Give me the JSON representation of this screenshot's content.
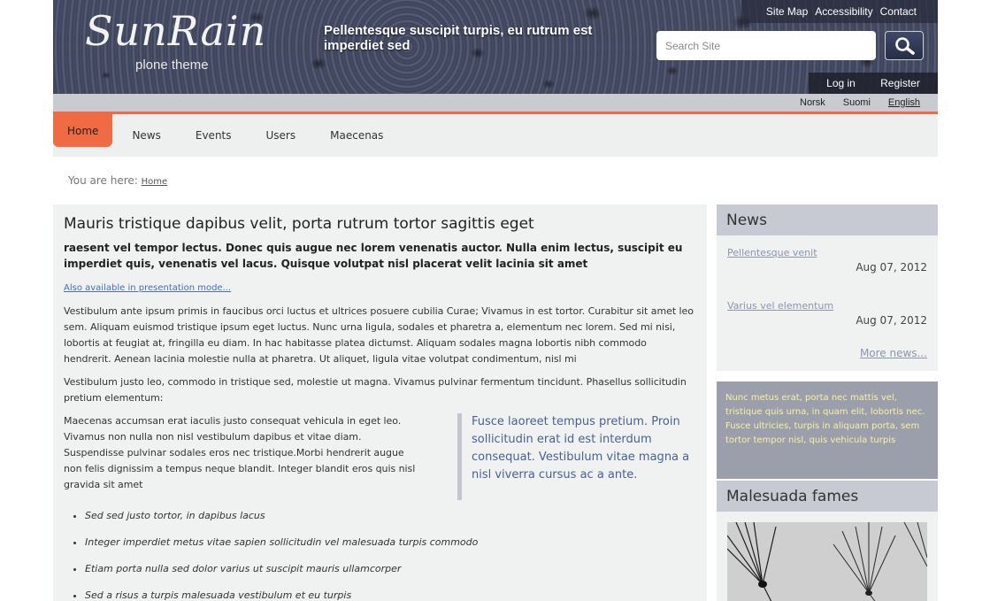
{
  "header": {
    "logo_title": "SunRain",
    "logo_subtitle": "plone theme",
    "tagline": "Pellentesque suscipit turpis, eu rutrum est imperdiet sed",
    "site_actions": [
      "Site Map",
      "Accessibility",
      "Contact"
    ],
    "search_placeholder": "Search Site",
    "auth": {
      "login": "Log in",
      "register": "Register"
    },
    "search_icon": "magnifier-icon"
  },
  "languages": [
    {
      "label": "Norsk",
      "current": false
    },
    {
      "label": "Suomi",
      "current": false
    },
    {
      "label": "English",
      "current": true
    }
  ],
  "nav": {
    "tabs": [
      "Home",
      "News",
      "Events",
      "Users",
      "Maecenas"
    ],
    "active": "Home",
    "accent_color": "#f06a44"
  },
  "breadcrumb": {
    "prefix": "You are here:",
    "home": "Home"
  },
  "content": {
    "title": "Mauris tristique dapibus velit, porta rutrum tortor sagittis eget",
    "description": "raesent vel tempor lectus. Donec quis augue nec lorem venenatis auctor. Nulla enim lectus, suscipit eu imperdiet quis, venenatis vel lacus. Quisque volutpat nisl placerat velit lacinia sit amet",
    "presentation_link": "Also available in presentation mode...",
    "paragraph1": "Vestibulum ante ipsum primis in faucibus orci luctus et ultrices posuere cubilia Curae; Vivamus in est tortor. Curabitur sit amet leo sem. Aliquam euismod tristique ipsum eget luctus. Nunc urna ligula, sodales et pharetra a, elementum nec lorem. Sed mi nisi, lobortis at feugiat at, fringilla eu diam. In hac habitasse platea dictumst. Aliquam sodales magna lobortis nibh commodo hendrerit. Aenean lacinia molestie nulla at pharetra. Ut aliquet, ligula vitae volutpat condimentum, nisl mi",
    "paragraph2": "Vestibulum justo leo, commodo in tristique sed, molestie ut magna. Vivamus pulvinar fermentum tincidunt. Phasellus sollicitudin pretium elementum:",
    "paragraph3": "Maecenas accumsan erat iaculis justo consequat vehicula in eget leo. Vivamus non nulla non nisl vestibulum dapibus et vitae diam. Suspendisse pulvinar sodales eros nec tristique.Morbi hendrerit augue non felis dignissim a tempus neque blandit. Integer blandit eros quis nisl gravida sit amet",
    "pullquote": "Fusce laoreet tempus pretium. Proin sollicitudin erat id est interdum consequat. Vestibulum vitae magna a nisl viverra cursus ac a ante.",
    "bullets": [
      "Sed sed justo tortor, in dapibus lacus",
      "Integer imperdiet metus vitae sapien sollicitudin vel malesuada turpis commodo",
      "Etiam porta nulla sed dolor varius ut suscipit mauris ullamcorper",
      "Sed a risus a turpis malesuada vestibulum et eu turpis"
    ]
  },
  "sidebar": {
    "news": {
      "title": "News",
      "items": [
        {
          "title": "Pellentesque venit",
          "date": "Aug 07, 2012"
        },
        {
          "title": "Varius vel elementum",
          "date": "Aug 07, 2012"
        }
      ],
      "more": "More news..."
    },
    "static_text": "Nunc metus erat, porta nec mattis vel, tristique quis urna, in quam elit, lobortis nec. Fusce ultricies, turpis in aliquam porta, sem tortor tempor nisl, quis vehicula turpis",
    "image_portlet_title": "Malesuada fames"
  }
}
